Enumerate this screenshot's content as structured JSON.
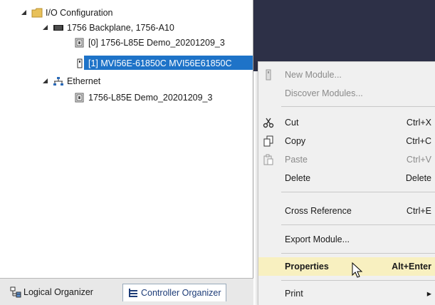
{
  "tree": {
    "io_config": "I/O Configuration",
    "backplane": "1756 Backplane, 1756-A10",
    "slot0": "[0] 1756-L85E Demo_20201209_3",
    "slot1": "[1] MVI56E-61850C MVI56E61850C",
    "ethernet": "Ethernet",
    "eth_device": "1756-L85E Demo_20201209_3"
  },
  "tabs": {
    "logical": "Logical Organizer",
    "controller": "Controller Organizer"
  },
  "menu": {
    "new_module": "New Module...",
    "discover_modules": "Discover Modules...",
    "cut": "Cut",
    "cut_sc": "Ctrl+X",
    "copy": "Copy",
    "copy_sc": "Ctrl+C",
    "paste": "Paste",
    "paste_sc": "Ctrl+V",
    "delete": "Delete",
    "delete_sc": "Delete",
    "cross_reference": "Cross Reference",
    "cross_reference_sc": "Ctrl+E",
    "export_module": "Export Module...",
    "properties": "Properties",
    "properties_sc": "Alt+Enter",
    "print": "Print",
    "print_sc": "▸"
  },
  "colors": {
    "selection": "#1e73c8",
    "highlight": "#f8f0c0",
    "dark_pane": "#2d3047"
  }
}
